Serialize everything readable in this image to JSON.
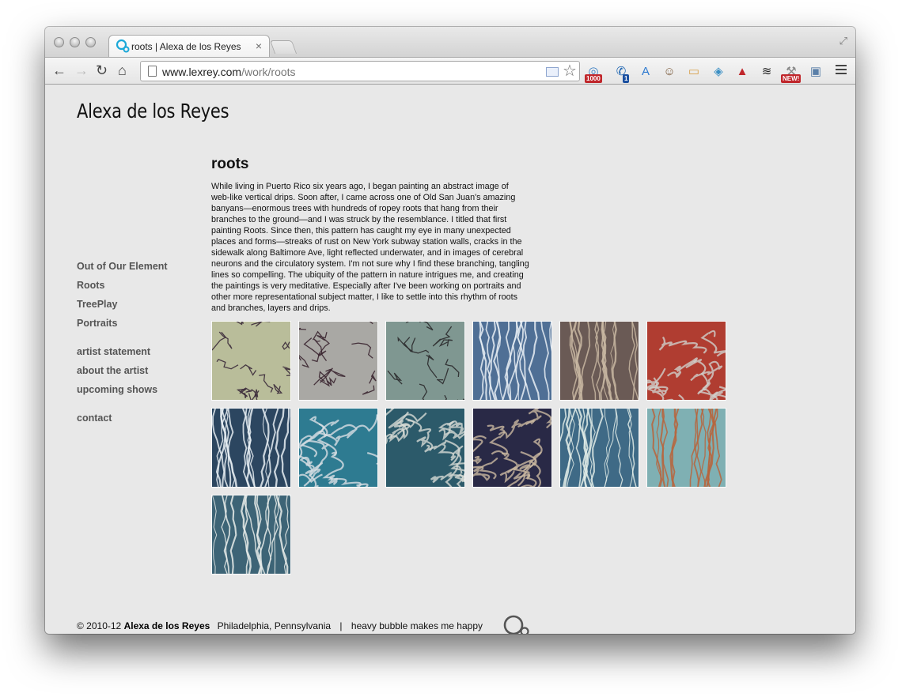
{
  "browser": {
    "tab_title": "roots | Alexa de los Reyes",
    "tab_close": "×",
    "url_host": "www.lexrey.com",
    "url_path": "/work/roots",
    "badges": [
      "1000",
      "1",
      "NEW!"
    ],
    "accent": "#1ba8d8"
  },
  "site": {
    "title": "Alexa de los Reyes"
  },
  "nav": {
    "work": [
      "Out of Our Element",
      "Roots",
      "TreePlay",
      "Portraits"
    ],
    "info": [
      "artist statement",
      "about the artist",
      "upcoming shows"
    ],
    "contact": "contact"
  },
  "content": {
    "heading": "roots",
    "body": "While living in Puerto Rico six years ago, I began painting an abstract image of web-like vertical drips. Soon after, I came across one of Old San Juan's amazing banyans—enormous trees with hundreds of ropey roots that hang from their branches to the ground—and I was struck by the resemblance. I titled that first painting Roots. Since then, this pattern has caught my eye in many unexpected places and forms—streaks of rust on New York subway station walls, cracks in the sidewalk along Baltimore Ave, light reflected underwater, and in images of cerebral neurons and the circulatory system. I'm not sure why I find these branching, tangling lines so compelling. The ubiquity of the pattern in nature intrigues me, and creating the paintings is very meditative. Especially after I've been working on portraits and other more representational subject matter, I like to settle into this rhythm of roots and branches, layers and drips.",
    "thumbnails": [
      {
        "bg": "#b9bd9a",
        "line": "#3b2a3a",
        "style": "crack"
      },
      {
        "bg": "#a9a8a4",
        "line": "#3a2530",
        "style": "crack"
      },
      {
        "bg": "#7f9791",
        "line": "#2b2a2c",
        "style": "crack"
      },
      {
        "bg": "#4f6f95",
        "line": "#e8eef4",
        "style": "drip"
      },
      {
        "bg": "#6a5a55",
        "line": "#c8b7a2",
        "style": "drip"
      },
      {
        "bg": "#b03d31",
        "line": "#cfd0cc",
        "style": "net"
      },
      {
        "bg": "#2c4660",
        "line": "#e6edf2",
        "style": "drip"
      },
      {
        "bg": "#2e7b91",
        "line": "#d8dfe3",
        "style": "net"
      },
      {
        "bg": "#2c5a6a",
        "line": "#d6d9d4",
        "style": "net"
      },
      {
        "bg": "#292946",
        "line": "#c9b8a0",
        "style": "net"
      },
      {
        "bg": "#3f6a86",
        "line": "#e2ece8",
        "style": "drip"
      },
      {
        "bg": "#7fb0b3",
        "line": "#b8643b",
        "style": "drip"
      },
      {
        "bg": "#3d6476",
        "line": "#e8ecea",
        "style": "drip"
      }
    ]
  },
  "footer": {
    "copyright": "© 2010-12",
    "name": "Alexa de los Reyes",
    "location": "Philadelphia, Pennsylvania",
    "separator": "|",
    "credit": "heavy bubble makes me happy"
  }
}
